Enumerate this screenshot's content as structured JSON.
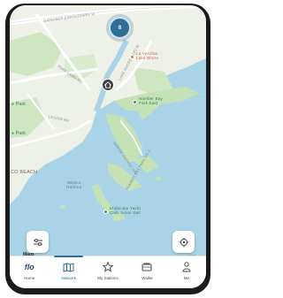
{
  "map": {
    "cluster_count": "8",
    "labels": {
      "road_gardiner": "GARDINER EXPRESSWAY W",
      "road_park_lawn": "PARK LAWN RD",
      "road_lake_shore": "LAKE SHORE BLVD W",
      "road_marine": "MARINE PARADE DR",
      "road_humber_bay": "HUMBER BAY PARK RD E",
      "park_left_top": "Park",
      "park_left_mid": "Park",
      "road_legion": "LEGION RD",
      "beach": "CO BEACH",
      "water_mimico": "Mimico\nHarbour",
      "poi_la_vecchia": "La Vecchia\nLake Shore",
      "poi_humber_bay": "Humber Bay\nPark East",
      "poi_etobicoke": "Etobicoke Yacht\nClub Junior Sail"
    },
    "attribution": "Maps",
    "legal": "Legal"
  },
  "controls": {
    "filter_icon": "sliders-icon",
    "locate_icon": "crosshair-icon"
  },
  "tabbar": {
    "items": [
      {
        "label": "Home",
        "icon": "flo-logo-icon"
      },
      {
        "label": "Network",
        "icon": "map-icon"
      },
      {
        "label": "My Stations",
        "icon": "star-icon"
      },
      {
        "label": "Wallet",
        "icon": "wallet-icon"
      },
      {
        "label": "Me",
        "icon": "person-icon"
      }
    ],
    "active": "Network"
  },
  "colors": {
    "water": "#a9d4e8",
    "land": "#eef1e8",
    "park": "#cfe6c2",
    "accent": "#2e6e96"
  }
}
